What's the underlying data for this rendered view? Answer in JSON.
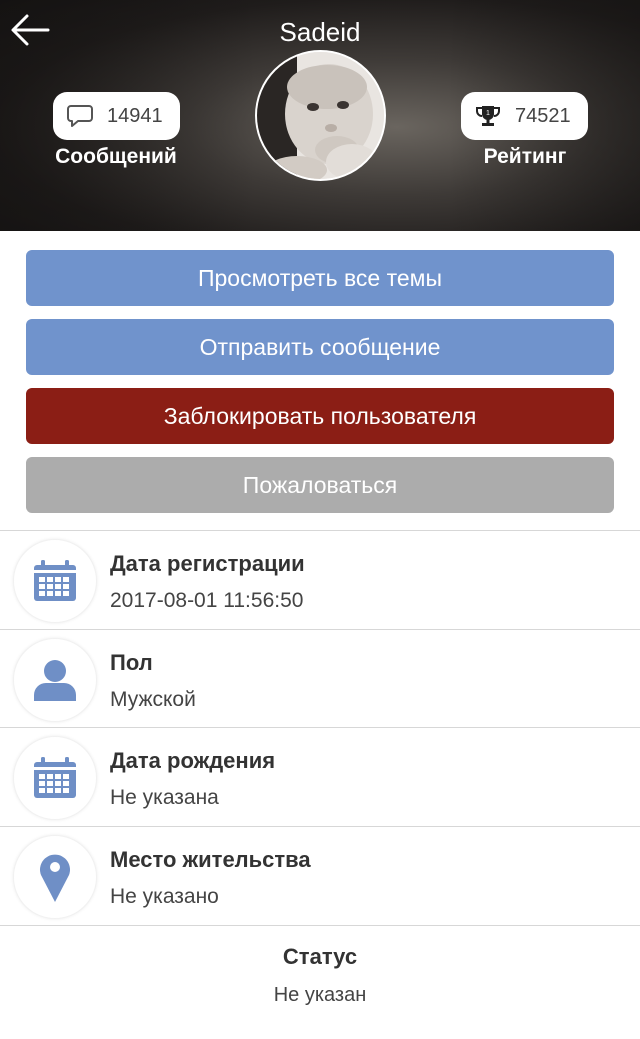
{
  "header": {
    "username": "Sadeid",
    "messages": {
      "count": "14941",
      "label": "Сообщений",
      "icon": "speech-bubble-icon"
    },
    "rating": {
      "count": "74521",
      "label": "Рейтинг",
      "icon": "trophy-icon"
    }
  },
  "actions": {
    "view_topics": "Просмотреть все темы",
    "send_message": "Отправить сообщение",
    "block_user": "Заблокировать пользователя",
    "report": "Пожаловаться"
  },
  "info": [
    {
      "icon": "calendar-icon",
      "title": "Дата регистрации",
      "value": "2017-08-01 11:56:50"
    },
    {
      "icon": "person-icon",
      "title": "Пол",
      "value": "Мужской"
    },
    {
      "icon": "calendar-icon",
      "title": "Дата рождения",
      "value": "Не указана"
    },
    {
      "icon": "location-pin-icon",
      "title": "Место жительства",
      "value": "Не указано"
    }
  ],
  "status": {
    "title": "Статус",
    "value": "Не указан"
  },
  "colors": {
    "primary_button": "#7093cc",
    "danger_button": "#8b1e15",
    "neutral_button": "#acacac",
    "info_icon": "#6f8fc6"
  }
}
